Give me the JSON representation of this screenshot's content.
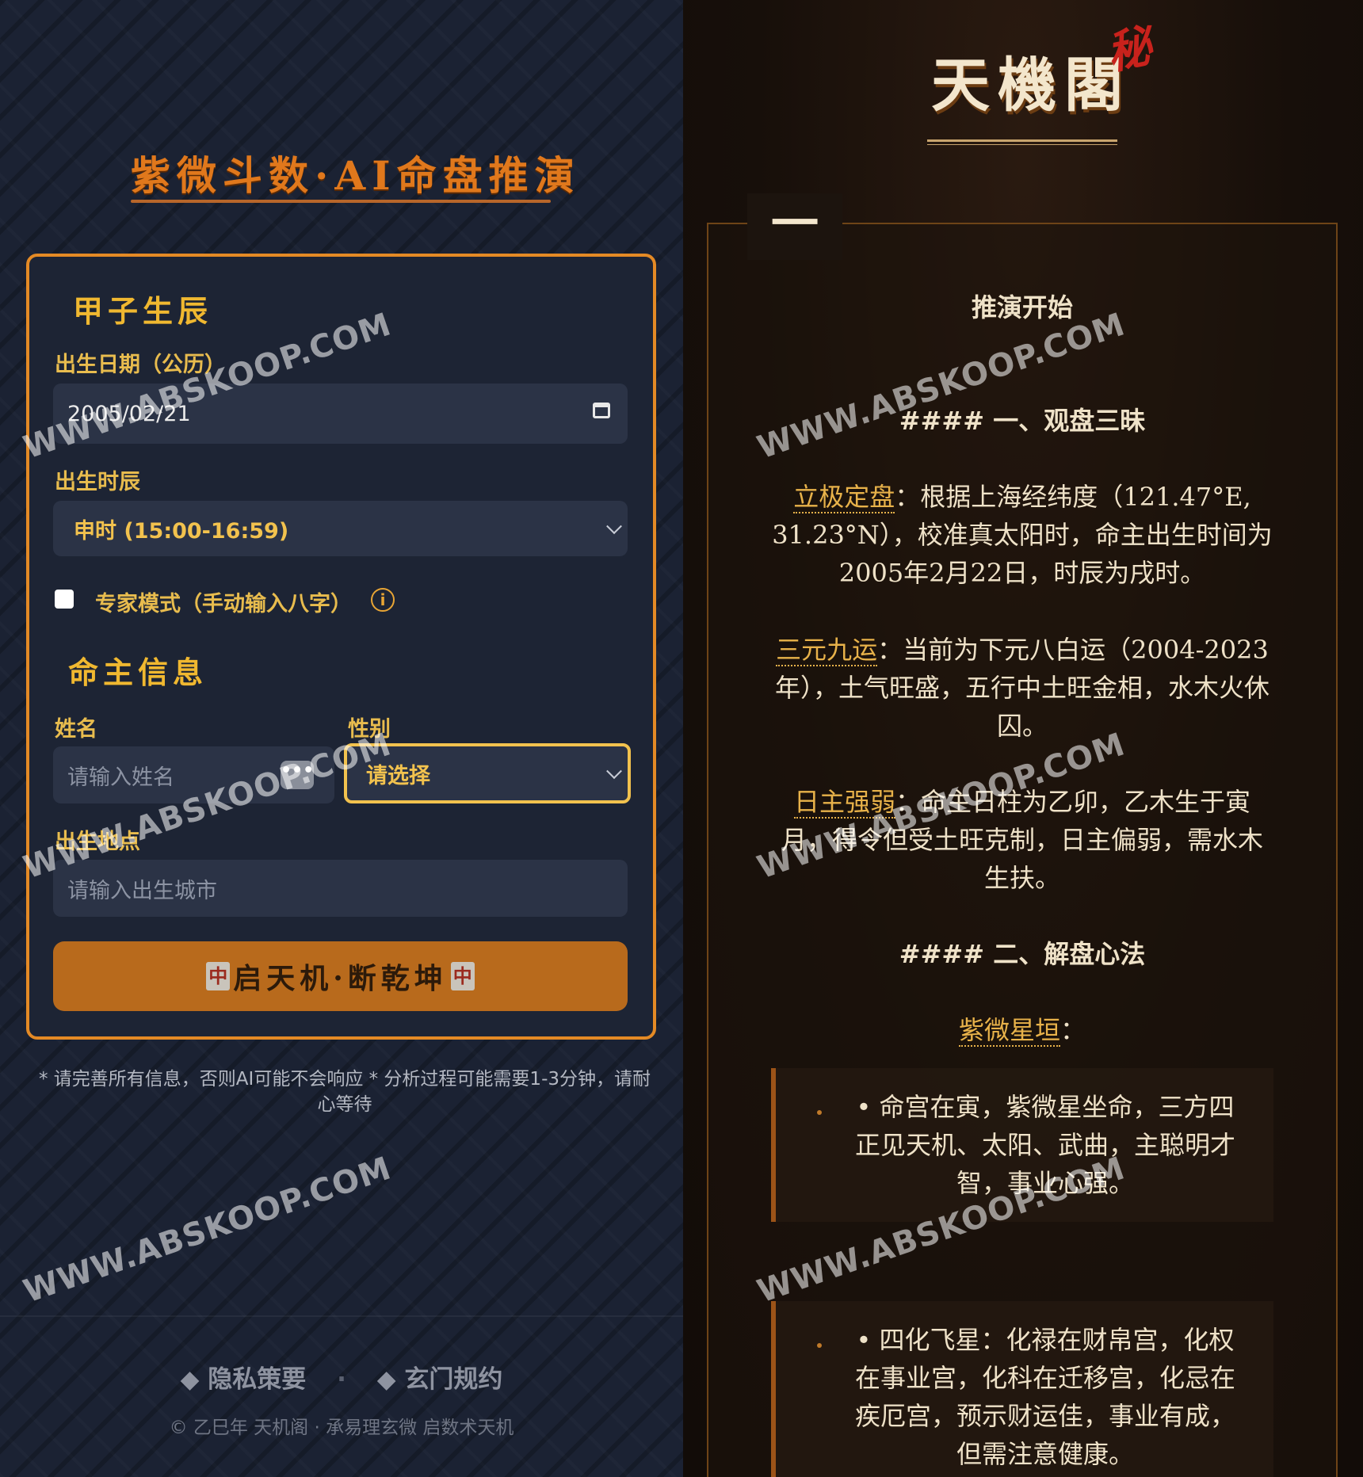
{
  "left_panel": {
    "title": "紫微斗数·AI命盘推演",
    "section_birth": "甲子生辰",
    "birth_date_label": "出生日期（公历）",
    "birth_date_value": "2005/02/21",
    "birth_hour_label": "出生时辰",
    "birth_hour_value": "申时 (15:00-16:59)",
    "expert_mode_label": "专家模式（手动输入八字）",
    "info_glyph": "i",
    "section_owner": "命主信息",
    "name_label": "姓名",
    "name_placeholder": "请输入姓名",
    "dots_glyph": "•••",
    "gender_label": "性别",
    "gender_value": "请选择",
    "birthplace_label": "出生地点",
    "birthplace_placeholder": "请输入出生城市",
    "submit_label": "启天机·断乾坤",
    "submit_tile": "中",
    "hint": "* 请完善所有信息，否则AI可能不会响应 * 分析过程可能需要1-3分钟，请耐心等待",
    "footer_links": [
      "◆ 隐私策要",
      "·",
      "◆ 玄门规约"
    ],
    "copyright": "© 乙巳年 天机阁 · 承易理玄微 启数术天机"
  },
  "right_panel": {
    "brand": "天機閣",
    "brand_seal": "秘",
    "tab_label": "一",
    "start_text": "推演开始",
    "heading1": "#### 一、观盘三昧",
    "p1_term": "立极定盘",
    "p1_text": "：根据上海经纬度（121.47°E, 31.23°N），校准真太阳时，命主出生时间为2005年2月22日，时辰为戌时。",
    "p2_term": "三元九运",
    "p2_text": "：当前为下元八白运（2004-2023年），土气旺盛，五行中土旺金相，水木火休囚。",
    "p3_term": "日主强弱",
    "p3_text": "：命主日柱为乙卯，乙木生于寅月，得令但受土旺克制，日主偏弱，需水木生扶。",
    "heading2": "#### 二、解盘心法",
    "p4_term": "紫微星垣",
    "p4_text": "：",
    "bullet1": "•  命宫在寅，紫微星坐命，三方四正见天机、太阳、武曲，主聪明才智，事业心强。",
    "bullet2": "•  四化飞星：化禄在财帛宫，化权在事业宫，化科在迁移宫，化忌在疾厄宫，预示财运佳，事业有成，但需注意健康。"
  },
  "watermark": "WWW.ABSKOOP.COM",
  "colors": {
    "accent_orange": "#e48a25",
    "label_gold": "#e8bc4e",
    "brand_red": "#c8221c",
    "term_gold": "#e8b24a"
  },
  "icons": [
    "calendar-icon",
    "chevron-down-icon",
    "info-icon",
    "more-dots-icon",
    "mahjong-tile-icon"
  ]
}
